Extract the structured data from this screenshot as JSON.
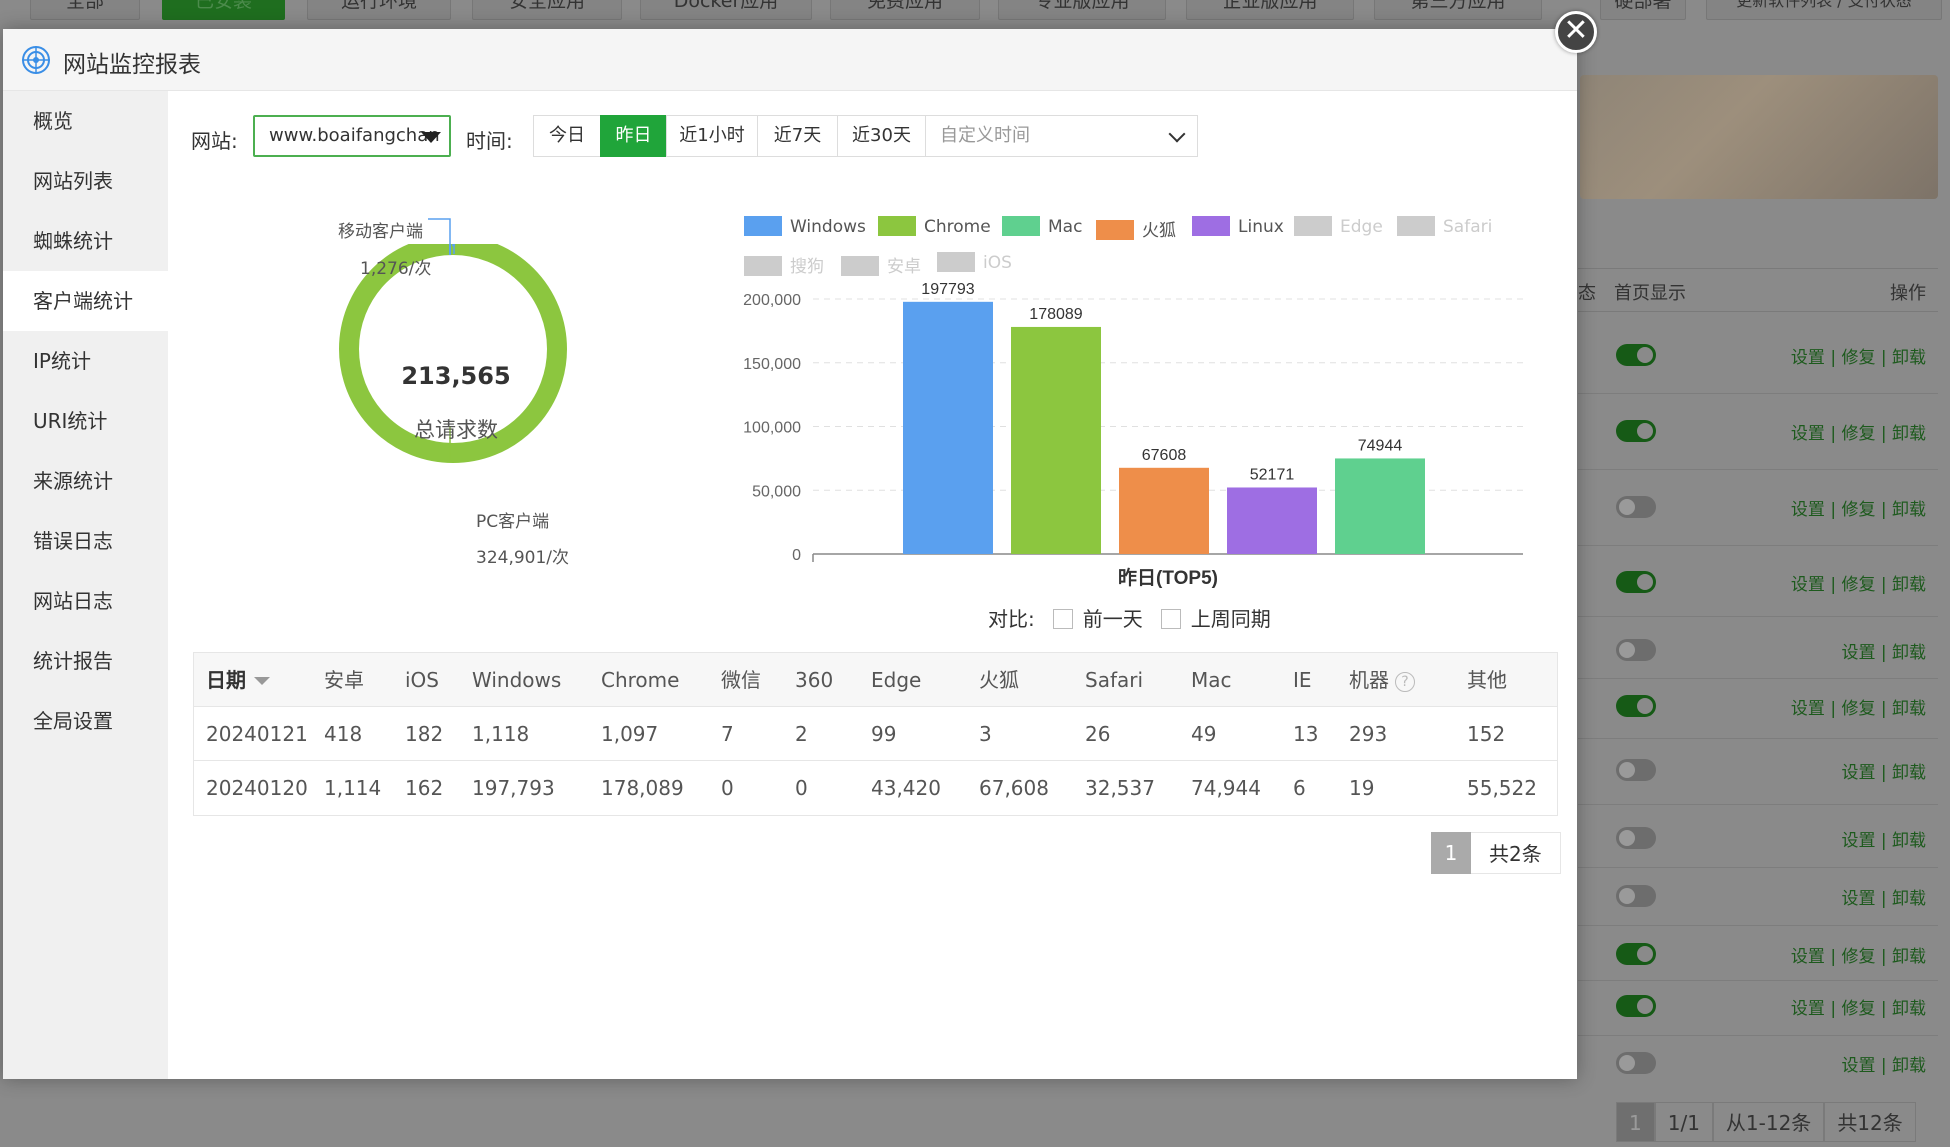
{
  "background": {
    "tabs": [
      "全部",
      "已安装",
      "运行环境",
      "安全应用",
      "Docker应用",
      "免费应用",
      "专业版应用",
      "企业版应用",
      "第三方应用",
      "…"
    ],
    "right_tabs": [
      "硬部署",
      "更新软件列表 / 支付状态"
    ],
    "table_headers": {
      "status": "态",
      "homepage": "首页显示",
      "ops": "操作"
    },
    "rows": [
      {
        "on": true,
        "actions": "设置 | 修复 | 卸载"
      },
      {
        "on": true,
        "actions": "设置 | 修复 | 卸载"
      },
      {
        "on": false,
        "actions": "设置 | 修复 | 卸载"
      },
      {
        "on": true,
        "actions": "设置 | 修复 | 卸载"
      },
      {
        "on": false,
        "actions": "设置 | 卸载"
      },
      {
        "on": true,
        "actions": "设置 | 修复 | 卸载"
      },
      {
        "on": false,
        "actions": "设置 | 卸载"
      },
      {
        "on": false,
        "actions": "设置 | 卸载"
      },
      {
        "on": false,
        "actions": "设置 | 卸载"
      },
      {
        "on": true,
        "actions": "设置 | 修复 | 卸载"
      },
      {
        "on": true,
        "actions": "设置 | 修复 | 卸载"
      },
      {
        "on": false,
        "actions": "设置 | 卸载"
      }
    ],
    "pager": {
      "page": "1",
      "pages": "1/1",
      "range": "从1-12条",
      "total": "共12条"
    }
  },
  "modal": {
    "title": "网站监控报表",
    "close": "✕"
  },
  "sidebar": {
    "items": [
      {
        "label": "概览"
      },
      {
        "label": "网站列表"
      },
      {
        "label": "蜘蛛统计"
      },
      {
        "label": "客户端统计",
        "active": true
      },
      {
        "label": "IP统计"
      },
      {
        "label": "URI统计"
      },
      {
        "label": "来源统计"
      },
      {
        "label": "错误日志"
      },
      {
        "label": "网站日志"
      },
      {
        "label": "统计报告"
      },
      {
        "label": "全局设置"
      }
    ]
  },
  "filters": {
    "site_label": "网站:",
    "site_value": "www.boaifangchan",
    "time_label": "时间:",
    "time_options": [
      "今日",
      "昨日",
      "近1小时",
      "近7天",
      "近30天"
    ],
    "time_active": "昨日",
    "custom_time_placeholder": "自定义时间"
  },
  "donut": {
    "total": "213,565",
    "total_label": "总请求数",
    "mobile_label": "移动客户端",
    "mobile_value": "1,276/次",
    "pc_label": "PC客户端",
    "pc_value": "324,901/次",
    "color": "#8cc63f"
  },
  "chart_data": {
    "type": "bar",
    "title": "昨日(TOP5)",
    "legend": [
      {
        "name": "Windows",
        "color": "#5aa0ef",
        "active": true
      },
      {
        "name": "Chrome",
        "color": "#8cc63f",
        "active": true
      },
      {
        "name": "Mac",
        "color": "#5fd08f",
        "active": true
      },
      {
        "name": "火狐",
        "color": "#ee8e4a",
        "active": true
      },
      {
        "name": "Linux",
        "color": "#9e6ee3",
        "active": true
      },
      {
        "name": "Edge",
        "color": "#cccccc",
        "active": false
      },
      {
        "name": "Safari",
        "color": "#cccccc",
        "active": false
      },
      {
        "name": "搜狗",
        "color": "#cccccc",
        "active": false
      },
      {
        "name": "安卓",
        "color": "#cccccc",
        "active": false
      },
      {
        "name": "iOS",
        "color": "#cccccc",
        "active": false
      }
    ],
    "bars": [
      {
        "name": "Windows",
        "value": 197793,
        "color": "#5aa0ef"
      },
      {
        "name": "Chrome",
        "value": 178089,
        "color": "#8cc63f"
      },
      {
        "name": "火狐",
        "value": 67608,
        "color": "#ee8e4a"
      },
      {
        "name": "Linux",
        "value": 52171,
        "color": "#9e6ee3"
      },
      {
        "name": "Mac",
        "value": 74944,
        "color": "#5fd08f"
      }
    ],
    "yticks": [
      "0",
      "50,000",
      "100,000",
      "150,000",
      "200,000"
    ],
    "ylim": [
      0,
      200000
    ],
    "grid": true
  },
  "compare": {
    "label": "对比:",
    "prev_day": "前一天",
    "last_week": "上周同期"
  },
  "table": {
    "headers": [
      "日期",
      "安卓",
      "iOS",
      "Windows",
      "Chrome",
      "微信",
      "360",
      "Edge",
      "火狐",
      "Safari",
      "Mac",
      "IE",
      "机器",
      "其他"
    ],
    "rows": [
      [
        "20240121",
        "418",
        "182",
        "1,118",
        "1,097",
        "7",
        "2",
        "99",
        "3",
        "26",
        "49",
        "13",
        "293",
        "152"
      ],
      [
        "20240120",
        "1,114",
        "162",
        "197,793",
        "178,089",
        "0",
        "0",
        "43,420",
        "67,608",
        "32,537",
        "74,944",
        "6",
        "19",
        "55,522"
      ]
    ],
    "help_icon": "?"
  },
  "pager": {
    "page": "1",
    "total": "共2条"
  }
}
